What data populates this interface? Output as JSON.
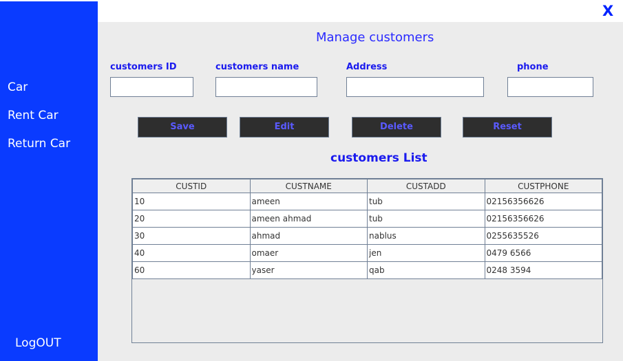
{
  "sidebar": {
    "items": [
      {
        "label": "Car"
      },
      {
        "label": "Rent Car"
      },
      {
        "label": "Return Car"
      }
    ],
    "logout": "LogOUT"
  },
  "window": {
    "close_label": "X"
  },
  "form": {
    "title": "Manage customers",
    "fields": [
      {
        "label": "customers ID",
        "value": ""
      },
      {
        "label": "customers name",
        "value": ""
      },
      {
        "label": "Address",
        "value": ""
      },
      {
        "label": "phone",
        "value": ""
      }
    ],
    "buttons": {
      "save": "Save",
      "edit": "Edit",
      "delete": "Delete",
      "reset": "Reset"
    }
  },
  "list": {
    "title": "customers List",
    "columns": [
      "CUSTID",
      "CUSTNAME",
      "CUSTADD",
      "CUSTPHONE"
    ],
    "rows": [
      [
        "10",
        "ameen",
        "tub",
        "02156356626"
      ],
      [
        "20",
        "ameen ahmad",
        "tub",
        "02156356626"
      ],
      [
        "30",
        "ahmad",
        "nablus",
        "0255635526"
      ],
      [
        "40",
        "omaer",
        "jen",
        "0479 6566"
      ],
      [
        "60",
        "yaser",
        "qab",
        "0248 3594"
      ]
    ]
  },
  "colors": {
    "sidebar": "#0a3bff",
    "accent": "#2a2aff",
    "button": "#2e2e2e",
    "button_text": "#5a5aff"
  }
}
